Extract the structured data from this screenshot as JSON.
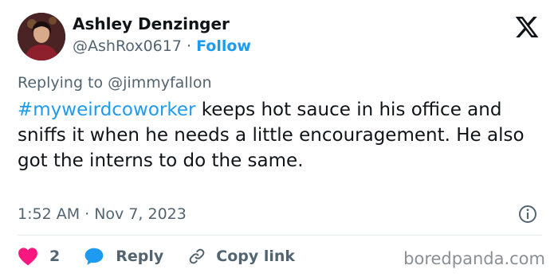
{
  "author": {
    "name": "Ashley Denzinger",
    "handle": "@AshRox0617",
    "separator": "·",
    "follow_label": "Follow"
  },
  "replying_to": "Replying to @jimmyfallon",
  "tweet": {
    "hashtag": "#myweirdcoworker",
    "text": " keeps hot sauce in his office and sniffs it when he needs a little encouragement. He also got the interns to do the same."
  },
  "timestamp": "1:52 AM · Nov 7, 2023",
  "actions": {
    "likes_count": "2",
    "reply_label": "Reply",
    "copy_link_label": "Copy link"
  },
  "watermark": "boredpanda.com",
  "colors": {
    "accent": "#1d9bf0",
    "like": "#f91880",
    "text": "#0f1419",
    "muted": "#536471"
  },
  "icons": [
    "x-logo-icon",
    "info-icon",
    "heart-icon",
    "reply-bubble-icon",
    "link-icon"
  ]
}
